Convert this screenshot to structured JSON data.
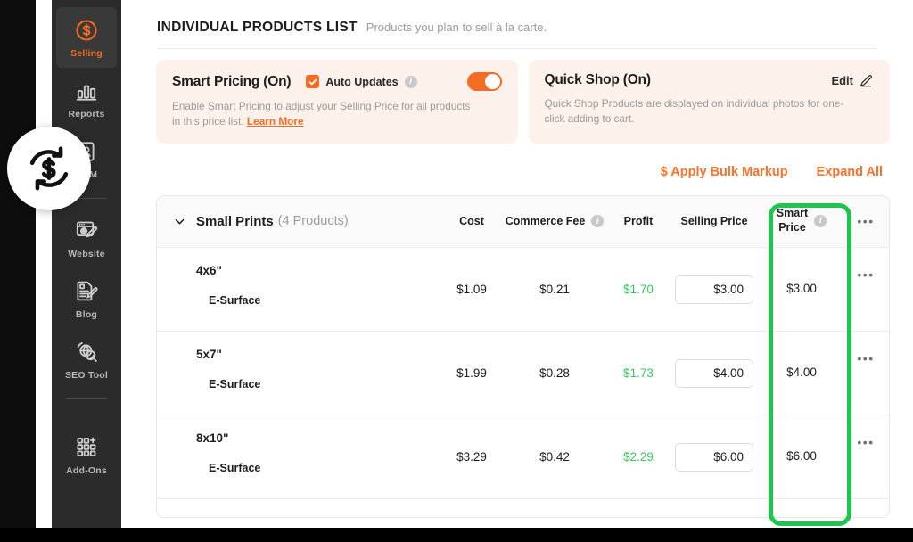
{
  "sidebar": {
    "items": [
      {
        "label": "Selling",
        "icon": "dollar-circle-icon",
        "active": true
      },
      {
        "label": "Reports",
        "icon": "bar-chart-icon",
        "active": false
      },
      {
        "label": "CRM",
        "icon": "contacts-icon",
        "active": false
      },
      {
        "label": "Website",
        "icon": "website-edit-icon",
        "active": false
      },
      {
        "label": "Blog",
        "icon": "blog-edit-icon",
        "active": false
      },
      {
        "label": "SEO Tool",
        "icon": "seo-globe-icon",
        "active": false
      },
      {
        "label": "Add-Ons",
        "icon": "grid-plus-icon",
        "active": false
      }
    ],
    "badge_icon": "auto-price-refresh-icon"
  },
  "header": {
    "title": "INDIVIDUAL PRODUCTS LIST",
    "subtitle": "Products you plan to sell à la carte."
  },
  "cards": {
    "smart_pricing": {
      "title": "Smart Pricing (On)",
      "checkbox_label": "Auto Updates",
      "checkbox_checked": true,
      "info_icon": "info-icon",
      "toggle_on": true,
      "description": "Enable Smart Pricing to adjust your Selling Price for all products in this price list. ",
      "link_label": "Learn More"
    },
    "quick_shop": {
      "title": "Quick Shop (On)",
      "edit_label": "Edit",
      "edit_icon": "pencil-icon",
      "description": "Quick Shop Products are displayed on individual photos for one-click adding to cart."
    }
  },
  "actions": {
    "bulk_markup": "$ Apply Bulk Markup",
    "expand_all": "Expand All"
  },
  "table": {
    "group_title": "Small Prints",
    "group_count": "(4 Products)",
    "chevron_icon": "chevron-down-icon",
    "columns": {
      "cost": "Cost",
      "commerce_fee": "Commerce Fee",
      "profit": "Profit",
      "selling_price": "Selling Price",
      "smart_price_line1": "Smart",
      "smart_price_line2": "Price",
      "overflow": "•••"
    },
    "rows": [
      {
        "product": "4x6\"",
        "variant": "E-Surface",
        "cost": "$1.09",
        "commerce_fee": "$0.21",
        "profit": "$1.70",
        "selling_price": "$3.00",
        "smart_price": "$3.00",
        "overflow": "•••"
      },
      {
        "product": "5x7\"",
        "variant": "E-Surface",
        "cost": "$1.99",
        "commerce_fee": "$0.28",
        "profit": "$1.73",
        "selling_price": "$4.00",
        "smart_price": "$4.00",
        "overflow": "•••"
      },
      {
        "product": "8x10\"",
        "variant": "E-Surface",
        "cost": "$3.29",
        "commerce_fee": "$0.42",
        "profit": "$2.29",
        "selling_price": "$6.00",
        "smart_price": "$6.00",
        "overflow": "•••"
      }
    ]
  },
  "annotation": {
    "highlight_color": "#1fc44d",
    "highlights": "smart-price-column"
  },
  "colors": {
    "accent": "#f26c23",
    "link": "#f8732b",
    "profit_green": "#3cc463",
    "card_bg": "#fdf1ec",
    "sidebar_bg": "#2b2b2b"
  }
}
